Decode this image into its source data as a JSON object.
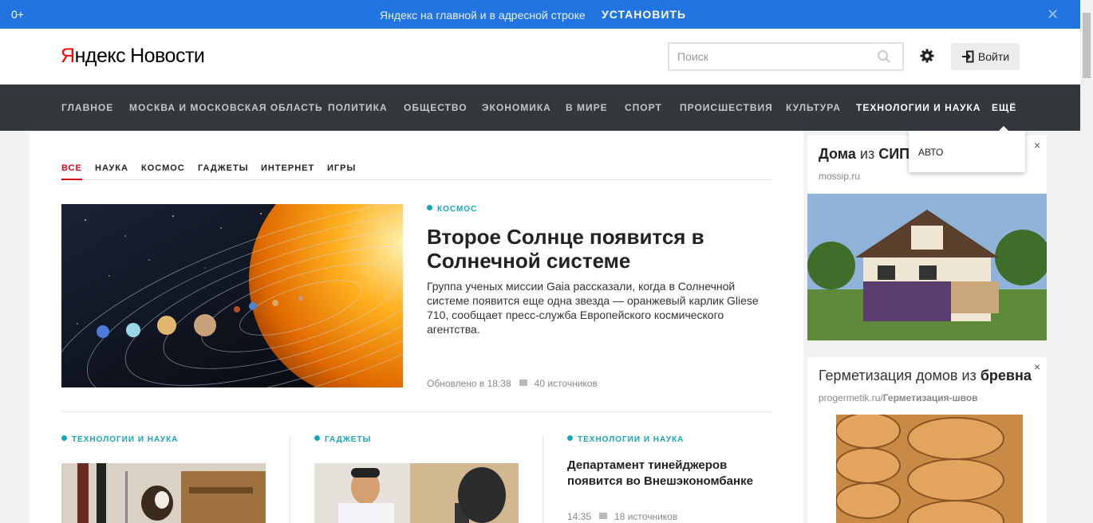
{
  "promo": {
    "age": "0+",
    "message": "Яндекс на главной и в адресной строке",
    "install": "УСТАНОВИТЬ",
    "close": "✕"
  },
  "header": {
    "logo_ya": "Я",
    "logo_ndex": "ндекс",
    "logo_news": "Новости",
    "search_placeholder": "Поиск",
    "login": "Войти"
  },
  "nav": {
    "items": [
      "ГЛАВНОЕ",
      "МОСКВА И МОСКОВСКАЯ ОБЛАСТЬ",
      "ПОЛИТИКА",
      "ОБЩЕСТВО",
      "ЭКОНОМИКА",
      "В МИРЕ",
      "СПОРТ",
      "ПРОИСШЕСТВИЯ",
      "КУЛЬТУРА",
      "ТЕХНОЛОГИИ И НАУКА",
      "ЕЩЁ"
    ],
    "active": "ТЕХНОЛОГИИ И НАУКА",
    "dropdown_item": "АВТО"
  },
  "tabs": {
    "items": [
      "ВСЕ",
      "НАУКА",
      "КОСМОС",
      "ГАДЖЕТЫ",
      "ИНТЕРНЕТ",
      "ИГРЫ"
    ],
    "active": "ВСЕ"
  },
  "hero": {
    "rubric": "КОСМОС",
    "title": "Второе Солнце появится в Солнечной системе",
    "text": "Группа ученых миссии Gaia рассказали, когда в Солнечной системе появится еще одна звезда — оранжевый карлик Gliese 710, сообщает пресс-служба Европейского космического агентства.",
    "updated": "Обновлено в 18:38",
    "sources": "40 источников"
  },
  "cards": [
    {
      "rubric": "ТЕХНОЛОГИИ И НАУКА"
    },
    {
      "rubric": "ГАДЖЕТЫ"
    },
    {
      "rubric": "ТЕХНОЛОГИИ И НАУКА",
      "title": "Департамент тинейджеров появится во Внешэкономбанке",
      "time": "14:35",
      "sources": "18 источников"
    }
  ],
  "ads": [
    {
      "title_prefix": "Дома",
      "title_mid": " из ",
      "title_bold": "СИП",
      "domain": "mossip.ru"
    },
    {
      "title_prefix": "Герметизация домов из ",
      "title_bold": "бревна",
      "domain_prefix": "progermetik.ru/",
      "domain_bold": "Герметизация-швов"
    }
  ],
  "ad_close": "×",
  "colors": {
    "promo": "#2275e0",
    "nav": "#33383d",
    "accent_red": "#d6021b",
    "rubric": "#17a6b6"
  }
}
